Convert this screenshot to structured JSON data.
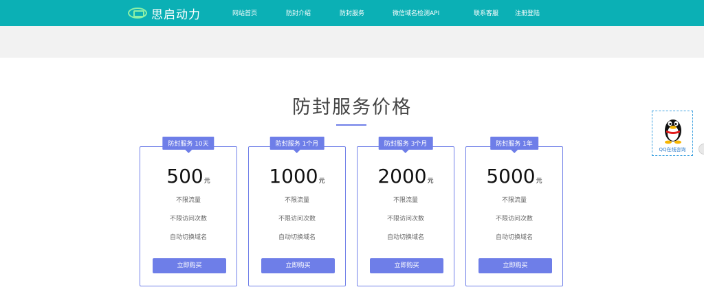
{
  "header": {
    "logo_text": "思启动力",
    "nav": [
      "网站首页",
      "防封介绍",
      "防封服务",
      "微信域名检测API",
      "联系客服",
      "注册登陆"
    ]
  },
  "section": {
    "title": "防封服务价格"
  },
  "plans": [
    {
      "badge": "防封服务 10天",
      "price": "500",
      "unit": "元",
      "features": [
        "不限流量",
        "不限访问次数",
        "自动切换域名"
      ],
      "button": "立即购买"
    },
    {
      "badge": "防封服务 1个月",
      "price": "1000",
      "unit": "元",
      "features": [
        "不限流量",
        "不限访问次数",
        "自动切换域名"
      ],
      "button": "立即购买"
    },
    {
      "badge": "防封服务 3个月",
      "price": "2000",
      "unit": "元",
      "features": [
        "不限流量",
        "不限访问次数",
        "自动切换域名"
      ],
      "button": "立即购买"
    },
    {
      "badge": "防封服务 1年",
      "price": "5000",
      "unit": "元",
      "features": [
        "不限流量",
        "不限访问次数",
        "自动切换域名"
      ],
      "button": "立即购买"
    }
  ],
  "qq_widget": {
    "label": "QQ在线咨询",
    "icon": "qq-penguin-icon"
  },
  "colors": {
    "header_bg": "#0bb0b5",
    "accent": "#6e7ee8",
    "band_bg": "#f2f2f2"
  }
}
